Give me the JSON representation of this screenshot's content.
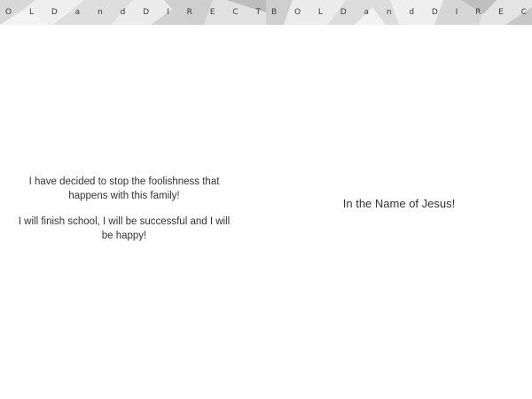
{
  "left_panel": {
    "banner_letters": [
      "O",
      "L",
      "D",
      "a",
      "n",
      "d",
      "D",
      "I",
      "R",
      "E",
      "C",
      "T"
    ],
    "paragraphs": [
      "I have decided to stop the foolishness that happens with this family!",
      "I will finish school, I will be successful and I will be happy!"
    ]
  },
  "right_panel": {
    "banner_letters": [
      "B",
      "O",
      "L",
      "D",
      "a",
      "n",
      "d",
      "D",
      "I",
      "R",
      "E",
      "C"
    ],
    "text": "In the Name of Jesus!"
  },
  "colors": {
    "banner_light": "#ececec",
    "banner_mid": "#d4d4d4",
    "banner_dark": "#b8b8b8",
    "text": "#333333"
  }
}
